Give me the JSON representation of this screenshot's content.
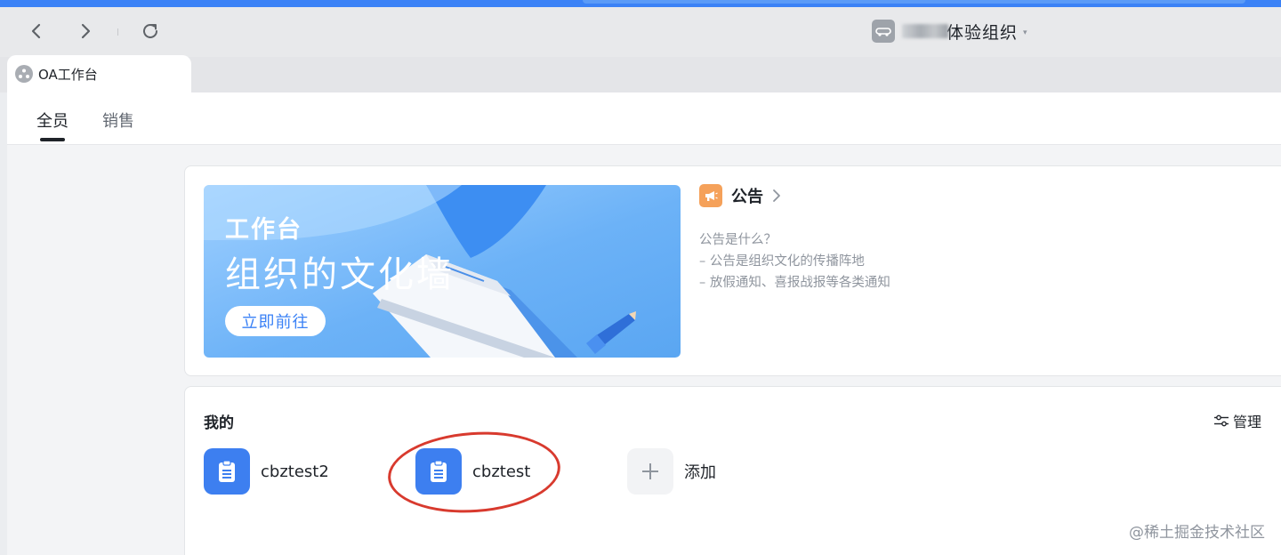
{
  "browser": {
    "back_icon": "chevron-left-icon",
    "forward_icon": "chevron-right-icon",
    "reload_icon": "reload-icon",
    "org_name": "体验组织",
    "org_caret": "▾"
  },
  "tab": {
    "label": "OA工作台"
  },
  "subnav": {
    "tabs": [
      {
        "label": "全员",
        "active": true
      },
      {
        "label": "销售",
        "active": false
      }
    ]
  },
  "banner": {
    "small_title": "工作台",
    "big_title": "组织的文化墙",
    "button_label": "立即前往"
  },
  "announcement": {
    "title": "公告",
    "chevron": "›",
    "lines": [
      "公告是什么？",
      "– 公告是组织文化的传播阵地",
      "– 放假通知、喜报战报等各类通知"
    ]
  },
  "mine": {
    "title": "我的",
    "manage_label": "管理",
    "apps": [
      {
        "label": "cbztest2",
        "icon": "clipboard-icon"
      },
      {
        "label": "cbztest",
        "icon": "clipboard-icon"
      }
    ],
    "add_label": "添加"
  },
  "watermark": "@稀土掘金技术社区",
  "colors": {
    "accent_blue": "#3d7ff0",
    "announce_orange": "#f5a15a",
    "highlight_red": "#d83a2e"
  }
}
